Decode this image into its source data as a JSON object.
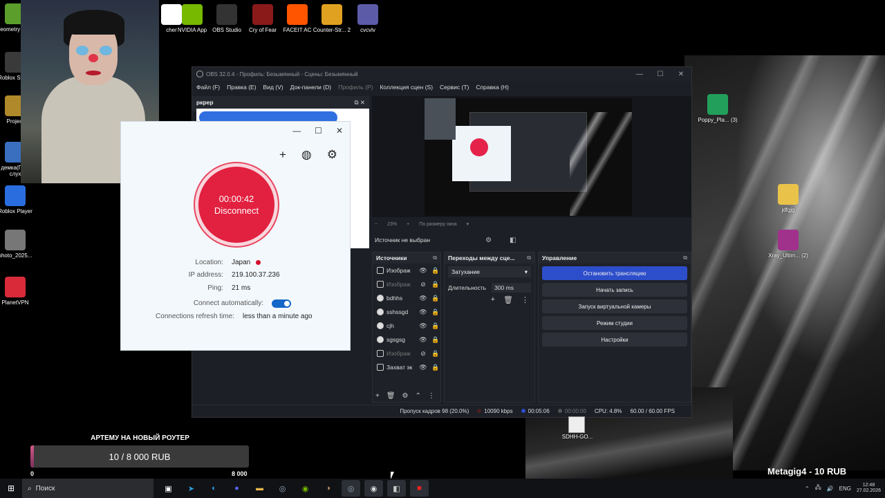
{
  "desktop": {
    "icons_left": [
      {
        "label": "Geometry Dash",
        "color": "#5b9e2c"
      },
      {
        "label": "Roblox Studio",
        "color": "#3a3a3a"
      },
      {
        "label": "Project",
        "color": "#b08a2a"
      },
      {
        "label": "демка(Г ты слух",
        "color": "#3a6fbf"
      },
      {
        "label": "Roblox Player",
        "color": "#2a6dde"
      },
      {
        "label": "photo_2025...",
        "color": "#777777"
      },
      {
        "label": "PlanetVPN",
        "color": "#d92a3a"
      }
    ],
    "icons_top": [
      {
        "label": "cher",
        "color": "#ffffff"
      },
      {
        "label": "NVIDIA App",
        "color": "#76b900"
      },
      {
        "label": "OBS Studio",
        "color": "#333333"
      },
      {
        "label": "Cry of Fear",
        "color": "#8a1a1a"
      },
      {
        "label": "FACEIT AC",
        "color": "#ff5500"
      },
      {
        "label": "Counter-Str... 2",
        "color": "#e0a020"
      },
      {
        "label": "cvcvlv",
        "color": "#5b5ba8"
      }
    ],
    "icons_right": [
      {
        "label": "Poppy_Pla... (3)",
        "color": "#22a05b"
      },
      {
        "label": "jdfgjg",
        "color": "#e9c24a"
      },
      {
        "label": "Xray_Ultim... (2)",
        "color": "#a0328c"
      },
      {
        "label": "SDHH-GO...",
        "color": "#eeeeee"
      }
    ]
  },
  "obs": {
    "title": "OBS 32.0.4 - Профиль: Безымянный - Сцены: Безымянный",
    "menu": [
      "Файл (F)",
      "Правка (E)",
      "Вид (V)",
      "Док-панели (D)",
      "Профиль (P)",
      "Коллекция сцен (S)",
      "Сервис (T)",
      "Справка (H)"
    ],
    "left_dock_title": "ркрер",
    "zoom": "23%",
    "zoom_mode": "По размеру окна",
    "no_source": "Источник не выбран",
    "sources_title": "Источники",
    "sources": [
      {
        "name": "Изображ",
        "dim": false,
        "icon": "image-icon",
        "visible": true
      },
      {
        "name": "Изображ",
        "dim": true,
        "icon": "image-icon",
        "visible": false
      },
      {
        "name": "bdhhs",
        "dim": false,
        "icon": "globe-icon",
        "visible": true
      },
      {
        "name": "sshssgd",
        "dim": false,
        "icon": "globe-icon",
        "visible": true
      },
      {
        "name": "cjh",
        "dim": false,
        "icon": "globe-icon",
        "visible": true
      },
      {
        "name": "sgsgsg",
        "dim": false,
        "icon": "globe-icon",
        "visible": true
      },
      {
        "name": "Изображ",
        "dim": true,
        "icon": "image-icon",
        "visible": false
      },
      {
        "name": "Захват эк",
        "dim": false,
        "icon": "monitor-icon",
        "visible": true
      }
    ],
    "transitions_title": "Переходы между сце...",
    "transition_value": "Затухание",
    "duration_label": "Длительность",
    "duration_value": "300 ms",
    "controls_title": "Управление",
    "controls": [
      {
        "label": "Остановить трансляцию",
        "active": true
      },
      {
        "label": "Начать запись",
        "active": false
      },
      {
        "label": "Запуск виртуальной камеры",
        "active": false
      },
      {
        "label": "Режим студии",
        "active": false
      },
      {
        "label": "Настройки",
        "active": false
      }
    ],
    "status": {
      "dropped": "Пропуск кадров 98 (20.0%)",
      "bitrate": "10090 kbps",
      "stream_time": "00:05:06",
      "rec_time": "00:00:00",
      "cpu": "CPU: 4.8%",
      "fps": "60.00 / 60.00 FPS"
    }
  },
  "vpn": {
    "timer": "00:00:42",
    "action": "Disconnect",
    "location_label": "Location:",
    "location_value": "Japan",
    "ip_label": "IP address:",
    "ip_value": "219.100.37.236",
    "ping_label": "Ping:",
    "ping_value": "21 ms",
    "auto_label": "Connect automatically:",
    "auto_on": true,
    "refresh_label": "Connections refresh time:",
    "refresh_value": "less than a minute ago",
    "accent": "#e2203f"
  },
  "donation": {
    "title": "АРТЕМУ НА НОВЫЙ РОУТЕР",
    "progress_text": "10 / 8 000 RUB",
    "current": 10,
    "goal": 8000,
    "min_label": "0",
    "max_label": "8 000"
  },
  "ticker": "Metagig4 - 10 RUB",
  "taskbar": {
    "search_placeholder": "Поиск",
    "lang": "ENG",
    "time": "12:48",
    "date": "27.02.2026"
  }
}
